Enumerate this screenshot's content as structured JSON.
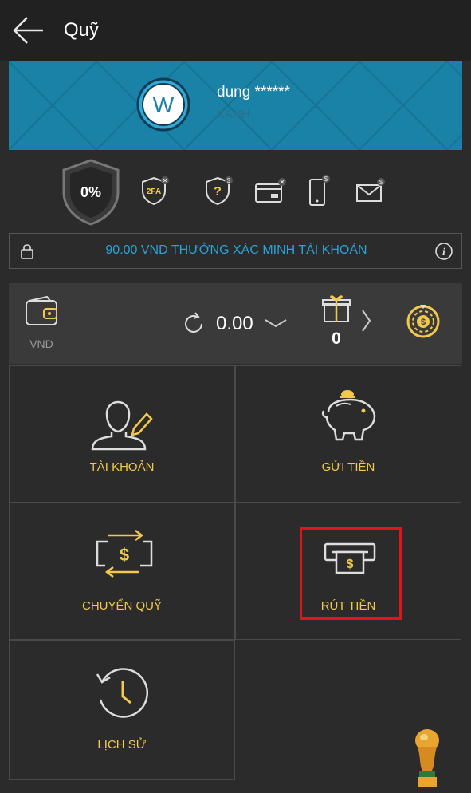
{
  "header": {
    "title": "Quỹ"
  },
  "profile": {
    "avatar_letter": "W",
    "username": "dung ******",
    "level": "XANH"
  },
  "security": {
    "percent": "0%",
    "twofa_label": "2FA"
  },
  "bonus": {
    "text": "90.00 VND THƯỞNG XÁC MINH TÀI KHOẢN"
  },
  "wallet": {
    "currency": "VND",
    "balance": "0.00",
    "gift_count": "0"
  },
  "menu": {
    "account": "TÀI KHOẢN",
    "deposit": "GỬI TIỀN",
    "transfer": "CHUYỂN QUỸ",
    "withdraw": "RÚT TIỀN",
    "history": "LỊCH SỬ"
  },
  "colors": {
    "accent": "#f2c94c",
    "banner": "#1a82a6",
    "link": "#29a3d9",
    "highlight": "#e0141a"
  }
}
